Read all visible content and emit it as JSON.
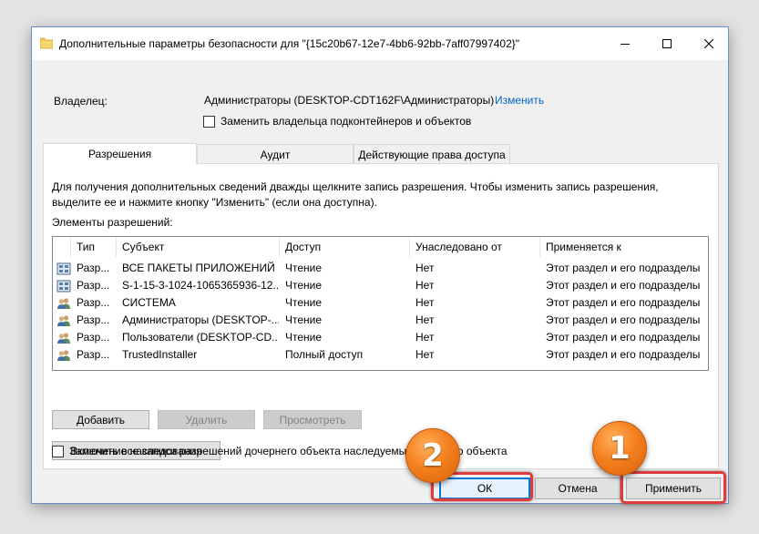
{
  "window": {
    "title": "Дополнительные параметры безопасности  для \"{15c20b67-12e7-4bb6-92bb-7aff07997402}\""
  },
  "owner": {
    "label": "Владелец:",
    "value": "Администраторы (DESKTOP-CDT162F\\Администраторы)",
    "change_link": "Изменить",
    "replace_checkbox_label": "Заменить владельца подконтейнеров и объектов"
  },
  "tabs": [
    {
      "label": "Разрешения",
      "active": true
    },
    {
      "label": "Аудит",
      "active": false
    },
    {
      "label": "Действующие права доступа",
      "active": false
    }
  ],
  "permissions": {
    "info_text": "Для получения дополнительных сведений дважды щелкните запись разрешения. Чтобы изменить запись разрешения, выделите ее и нажмите кнопку \"Изменить\" (если она доступна).",
    "list_caption": "Элементы разрешений:",
    "columns": [
      "Тип",
      "Субъект",
      "Доступ",
      "Унаследовано от",
      "Применяется к"
    ],
    "rows": [
      {
        "icon": "package-icon",
        "type": "Разр...",
        "subject": "ВСЕ ПАКЕТЫ ПРИЛОЖЕНИЙ",
        "access": "Чтение",
        "inherited": "Нет",
        "applies": "Этот раздел и его подразделы"
      },
      {
        "icon": "package-icon",
        "type": "Разр...",
        "subject": "S-1-15-3-1024-1065365936-12...",
        "access": "Чтение",
        "inherited": "Нет",
        "applies": "Этот раздел и его подразделы"
      },
      {
        "icon": "users-icon",
        "type": "Разр...",
        "subject": "СИСТЕМА",
        "access": "Чтение",
        "inherited": "Нет",
        "applies": "Этот раздел и его подразделы"
      },
      {
        "icon": "users-icon",
        "type": "Разр...",
        "subject": "Администраторы (DESKTOP-...",
        "access": "Чтение",
        "inherited": "Нет",
        "applies": "Этот раздел и его подразделы"
      },
      {
        "icon": "users-icon",
        "type": "Разр...",
        "subject": "Пользователи (DESKTOP-CD...",
        "access": "Чтение",
        "inherited": "Нет",
        "applies": "Этот раздел и его подразделы"
      },
      {
        "icon": "users-icon",
        "type": "Разр...",
        "subject": "TrustedInstaller",
        "access": "Полный доступ",
        "inherited": "Нет",
        "applies": "Этот раздел и его подразделы"
      }
    ],
    "add_button": "Добавить",
    "remove_button": "Удалить",
    "view_button": "Просмотреть",
    "inheritance_button": "Включение наследования"
  },
  "replace_child_label": "Заменить все записи разрешений дочернего объекта наследуемыми от этого объекта",
  "footer": {
    "ok": "ОК",
    "cancel": "Отмена",
    "apply": "Применить"
  },
  "badges": [
    "2",
    "1"
  ],
  "colors": {
    "link": "#0066cc",
    "highlight": "#e03a3a",
    "badge": "#f5801f",
    "ok_border": "#0078d7"
  }
}
